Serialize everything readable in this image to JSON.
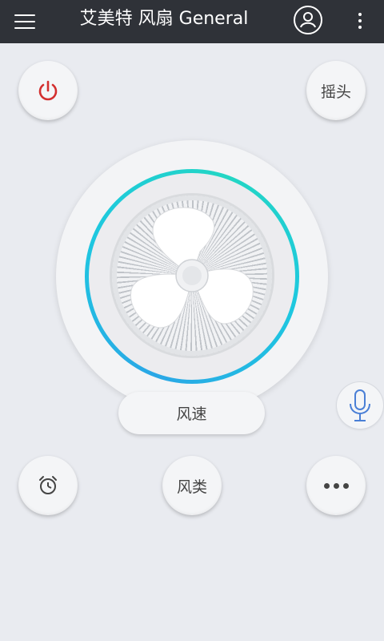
{
  "header": {
    "title": "艾美特 风扇 General",
    "menu_icon": "hamburger-menu-icon",
    "user_icon": "user-account-icon",
    "more_icon": "vertical-more-icon"
  },
  "controls": {
    "power_icon": "power-icon",
    "power_color": "#d32f2f",
    "swing_label": "摇头",
    "speed_label": "风速",
    "timer_icon": "alarm-clock-icon",
    "mode_label": "风类",
    "more_icon": "horizontal-more-icon",
    "mic_icon": "microphone-icon",
    "mic_color": "#4a7fd6"
  },
  "fan": {
    "icon": "fan-icon",
    "ring_colors": [
      "#2aa7e6",
      "#23d6c4"
    ]
  }
}
